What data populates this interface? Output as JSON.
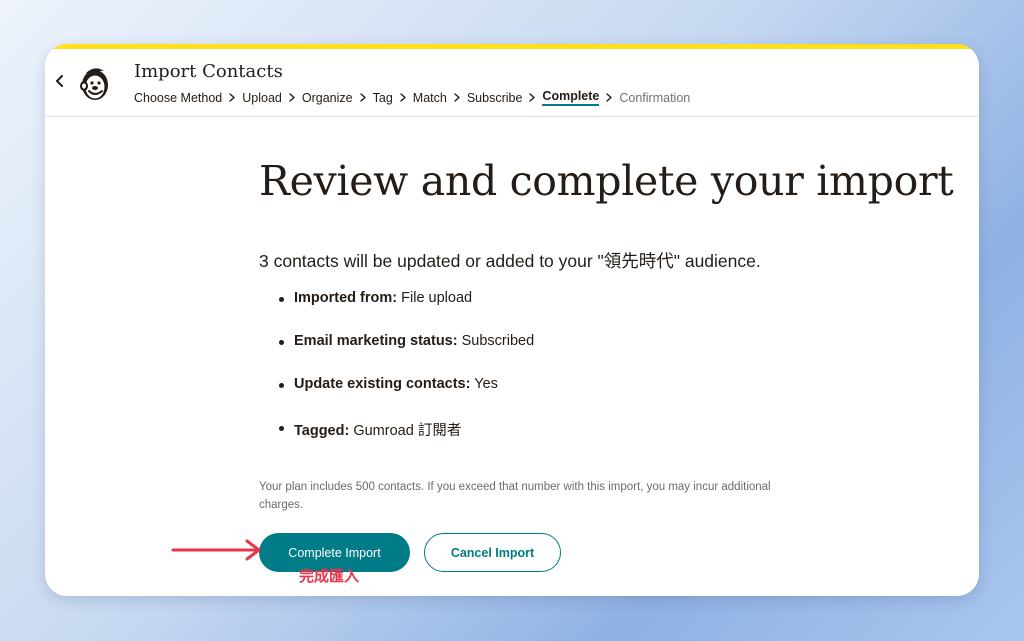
{
  "header": {
    "title": "Import Contacts",
    "breadcrumbs": [
      {
        "label": "Choose Method",
        "state": "done"
      },
      {
        "label": "Upload",
        "state": "done"
      },
      {
        "label": "Organize",
        "state": "done"
      },
      {
        "label": "Tag",
        "state": "done"
      },
      {
        "label": "Match",
        "state": "done"
      },
      {
        "label": "Subscribe",
        "state": "done"
      },
      {
        "label": "Complete",
        "state": "current"
      },
      {
        "label": "Confirmation",
        "state": "upcoming"
      }
    ]
  },
  "main": {
    "title": "Review and complete your import",
    "summary": "3 contacts will be updated or added to your \"領先時代\" audience.",
    "details": [
      {
        "label": "Imported from:",
        "value": "File upload"
      },
      {
        "label": "Email marketing status:",
        "value": "Subscribed"
      },
      {
        "label": "Update existing contacts:",
        "value": "Yes"
      },
      {
        "label": "Tagged:",
        "value": "Gumroad 訂閱者"
      }
    ],
    "plan_note": "Your plan includes 500 contacts. If you exceed that number with this import, you may incur additional charges.",
    "primary_button": "Complete Import",
    "secondary_button": "Cancel Import"
  },
  "annotation": {
    "text": "完成匯入",
    "color": "#e8354a"
  },
  "colors": {
    "accent": "#007c89",
    "brand_yellow": "#ffe01b",
    "text": "#241c15"
  }
}
